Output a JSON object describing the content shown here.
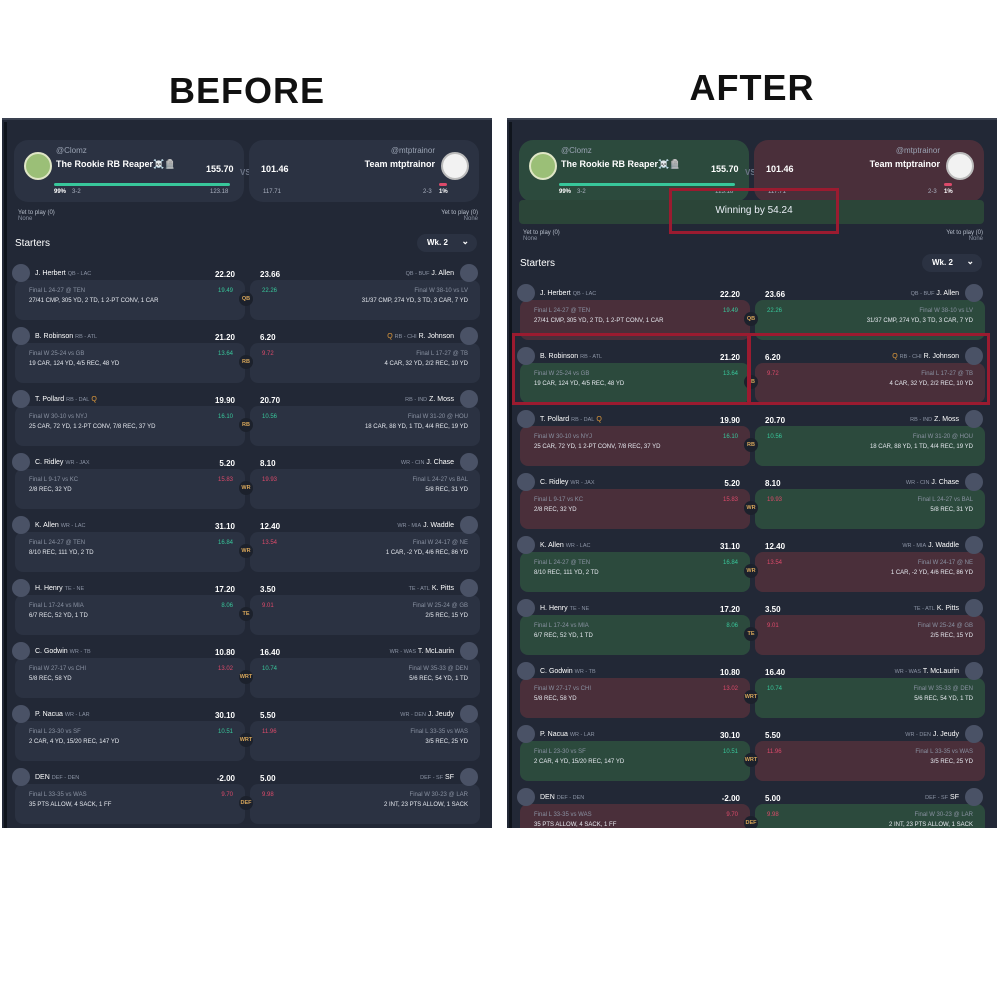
{
  "headings": {
    "before": "BEFORE",
    "after": "AFTER"
  },
  "matchup": {
    "home": {
      "handle": "@Clomz",
      "name": "The Rookie RB Reaper☠️🪦",
      "score": "155.70",
      "pct": "99%",
      "record": "3-2",
      "proj": "123.18"
    },
    "away": {
      "handle": "@mtptrainor",
      "name": "Team mtptrainor",
      "score": "101.46",
      "pct": "1%",
      "record": "2-3",
      "proj": "117.71"
    },
    "vs": "VS",
    "yet_to_play_label": "Yet to play (0)",
    "yet_to_play_value": "None",
    "winning_text": "Winning by 54.24"
  },
  "starters_label": "Starters",
  "week_label": "Wk. 2",
  "rows": [
    {
      "slot": "QB",
      "l": {
        "name": "J. Herbert",
        "pos": "QB - LAC",
        "pts": "22.20",
        "game": "Final L 24-27 @ TEN",
        "proj": "19.49",
        "pc": "green",
        "stat": "27/41 CMP, 305 YD, 2 TD, 1 2-PT CONV, 1 CAR"
      },
      "r": {
        "name": "J. Allen",
        "pos": "QB - BUF",
        "pts": "23.66",
        "game": "Final W 38-10 vs LV",
        "proj": "22.26",
        "pc": "green",
        "stat": "31/37 CMP, 274 YD, 3 TD, 3 CAR, 7 YD"
      },
      "win": "r"
    },
    {
      "slot": "RB",
      "l": {
        "name": "B. Robinson",
        "pos": "RB - ATL",
        "pts": "21.20",
        "game": "Final W 25-24 vs GB",
        "proj": "13.64",
        "pc": "green",
        "stat": "19 CAR, 124 YD, 4/5 REC, 48 YD"
      },
      "r": {
        "name": "R. Johnson",
        "pos": "RB - CHI",
        "pts": "6.20",
        "game": "Final L 17-27 @ TB",
        "proj": "9.72",
        "pc": "red",
        "stat": "4 CAR, 32 YD, 2/2 REC, 10 YD",
        "tag": "Q"
      },
      "win": "l"
    },
    {
      "slot": "RB",
      "l": {
        "name": "T. Pollard",
        "pos": "RB - DAL",
        "pts": "19.90",
        "game": "Final W 30-10 vs NYJ",
        "proj": "16.10",
        "pc": "green",
        "stat": "25 CAR, 72 YD, 1 2-PT CONV, 7/8 REC, 37 YD",
        "tag": "Q"
      },
      "r": {
        "name": "Z. Moss",
        "pos": "RB - IND",
        "pts": "20.70",
        "game": "Final W 31-20 @ HOU",
        "proj": "10.56",
        "pc": "green",
        "stat": "18 CAR, 88 YD, 1 TD, 4/4 REC, 19 YD"
      },
      "win": "r"
    },
    {
      "slot": "WR",
      "l": {
        "name": "C. Ridley",
        "pos": "WR - JAX",
        "pts": "5.20",
        "game": "Final L 9-17 vs KC",
        "proj": "15.83",
        "pc": "red",
        "stat": "2/8 REC, 32 YD"
      },
      "r": {
        "name": "J. Chase",
        "pos": "WR - CIN",
        "pts": "8.10",
        "game": "Final L 24-27 vs BAL",
        "proj": "19.93",
        "pc": "red",
        "stat": "5/8 REC, 31 YD"
      },
      "win": "r"
    },
    {
      "slot": "WR",
      "l": {
        "name": "K. Allen",
        "pos": "WR - LAC",
        "pts": "31.10",
        "game": "Final L 24-27 @ TEN",
        "proj": "16.84",
        "pc": "green",
        "stat": "8/10 REC, 111 YD, 2 TD"
      },
      "r": {
        "name": "J. Waddle",
        "pos": "WR - MIA",
        "pts": "12.40",
        "game": "Final W 24-17 @ NE",
        "proj": "13.54",
        "pc": "red",
        "stat": "1 CAR, -2 YD, 4/6 REC, 86 YD"
      },
      "win": "l"
    },
    {
      "slot": "TE",
      "l": {
        "name": "H. Henry",
        "pos": "TE - NE",
        "pts": "17.20",
        "game": "Final L 17-24 vs MIA",
        "proj": "8.06",
        "pc": "green",
        "stat": "6/7 REC, 52 YD, 1 TD"
      },
      "r": {
        "name": "K. Pitts",
        "pos": "TE - ATL",
        "pts": "3.50",
        "game": "Final W 25-24 @ GB",
        "proj": "9.01",
        "pc": "red",
        "stat": "2/5 REC, 15 YD"
      },
      "win": "l"
    },
    {
      "slot": "WRT",
      "l": {
        "name": "C. Godwin",
        "pos": "WR - TB",
        "pts": "10.80",
        "game": "Final W 27-17 vs CHI",
        "proj": "13.02",
        "pc": "red",
        "stat": "5/8 REC, 58 YD"
      },
      "r": {
        "name": "T. McLaurin",
        "pos": "WR - WAS",
        "pts": "16.40",
        "game": "Final W 35-33 @ DEN",
        "proj": "10.74",
        "pc": "green",
        "stat": "5/6 REC, 54 YD, 1 TD"
      },
      "win": "r"
    },
    {
      "slot": "WRT",
      "l": {
        "name": "P. Nacua",
        "pos": "WR - LAR",
        "pts": "30.10",
        "game": "Final L 23-30 vs SF",
        "proj": "10.51",
        "pc": "green",
        "stat": "2 CAR, 4 YD, 15/20 REC, 147 YD"
      },
      "r": {
        "name": "J. Jeudy",
        "pos": "WR - DEN",
        "pts": "5.50",
        "game": "Final L 33-35 vs WAS",
        "proj": "11.96",
        "pc": "red",
        "stat": "3/5 REC, 25 YD"
      },
      "win": "l"
    },
    {
      "slot": "DEF",
      "l": {
        "name": "DEN",
        "pos": "DEF - DEN",
        "pts": "-2.00",
        "game": "Final L 33-35 vs WAS",
        "proj": "9.70",
        "pc": "red",
        "stat": "35 PTS ALLOW, 4 SACK, 1 FF"
      },
      "r": {
        "name": "SF",
        "pos": "DEF - SF",
        "pts": "5.00",
        "game": "Final W 30-23 @ LAR",
        "proj": "9.98",
        "pc": "red",
        "stat": "2 INT, 23 PTS ALLOW, 1 SACK"
      },
      "win": "r"
    }
  ],
  "colors": {
    "panel": "#222836",
    "card": "#2b3242",
    "win_green": "#2c4a3d",
    "lose_red": "#4a2f3a",
    "highlight": "#9b1b30",
    "proj_good": "#38c79b",
    "proj_bad": "#dc4a6a"
  }
}
